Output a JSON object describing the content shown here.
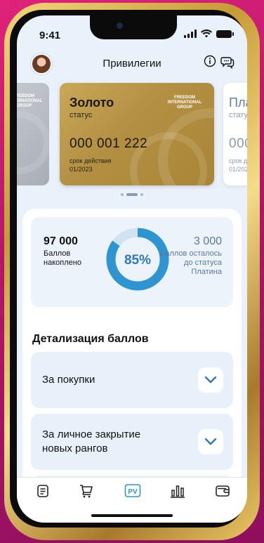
{
  "status_bar": {
    "time": "9:41"
  },
  "header": {
    "title": "Привилегии"
  },
  "cards": [
    {
      "brand": "FREEDOM INTERNATIONAL GROUP"
    },
    {
      "name": "Золото",
      "status_label": "статус",
      "number": "000 001 222",
      "expiry_label": "срок действия",
      "expiry": "01/2023",
      "brand": "FREEDOM INTERNATIONAL GROUP"
    },
    {
      "name": "Пла",
      "status_label": "стату",
      "number": "000",
      "expiry_label": "срок д",
      "expiry": "01/202"
    }
  ],
  "summary": {
    "accumulated_value": "97 000",
    "accumulated_label": "Баллов накоплено",
    "percent_text": "85%",
    "percent": 0.85,
    "remaining_value": "3 000",
    "remaining_label": "Баллов осталось до статуса Платина"
  },
  "details": {
    "title": "Детализация баллов",
    "items": [
      {
        "label": "За покупки"
      },
      {
        "label_line1": "За личное закрытие",
        "label_line2": "новых рангов"
      }
    ]
  },
  "tabs": [
    {
      "icon": "document-icon"
    },
    {
      "icon": "cart-icon"
    },
    {
      "icon": "pv-icon",
      "label": "PV",
      "active": true
    },
    {
      "icon": "bar-chart-icon"
    },
    {
      "icon": "wallet-icon"
    }
  ],
  "colors": {
    "accent": "#2f95d0",
    "gold": "#b8964a",
    "panel_bg": "#e9f1fb"
  }
}
